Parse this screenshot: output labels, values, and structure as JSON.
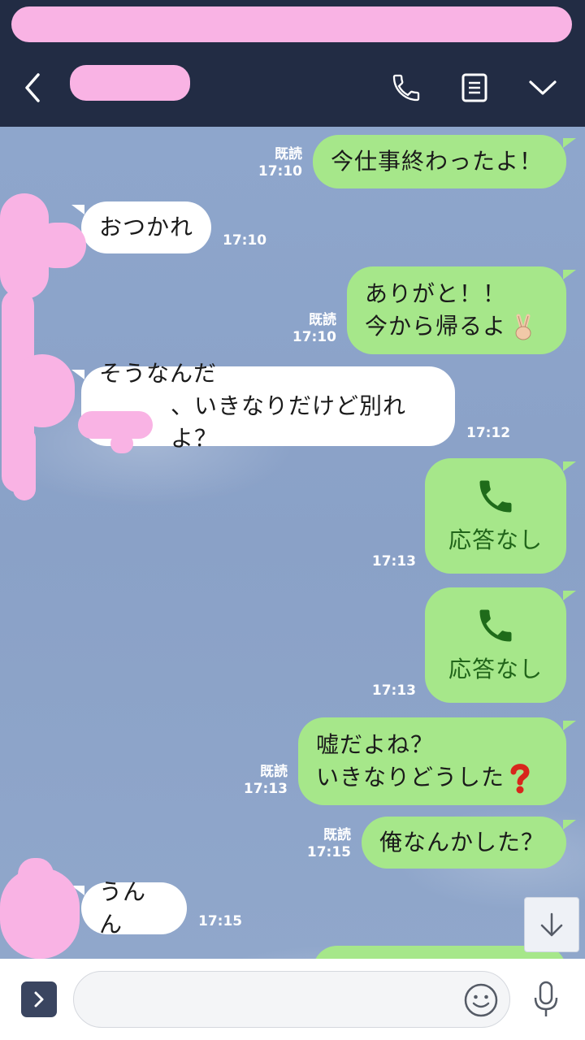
{
  "messages": [
    {
      "side": "out",
      "text": "今仕事終わったよ！",
      "read": "既読",
      "time": "17:10"
    },
    {
      "side": "in",
      "text": "おつかれ",
      "time": "17:10"
    },
    {
      "side": "out",
      "lines": [
        "ありがと！！",
        "今から帰るよ"
      ],
      "emoji": "victory-hand-emoji",
      "read": "既読",
      "time": "17:10"
    },
    {
      "side": "in",
      "lines": [
        "そうなんだ",
        "、いきなりだけど別れよ？"
      ],
      "time": "17:12"
    },
    {
      "side": "out",
      "type": "call",
      "text": "応答なし",
      "icon": "phone-icon",
      "time": "17:13"
    },
    {
      "side": "out",
      "type": "call",
      "text": "応答なし",
      "icon": "phone-icon",
      "time": "17:13"
    },
    {
      "side": "out",
      "lines": [
        "嘘だよね？",
        "いきなりどうした"
      ],
      "emoji": "red-question-mark-emoji",
      "read": "既読",
      "time": "17:13"
    },
    {
      "side": "out",
      "text": "俺なんかした？",
      "read": "既読",
      "time": "17:15"
    },
    {
      "side": "in",
      "text": "うんん",
      "time": "17:15"
    }
  ],
  "colors": {
    "header_bg": "#222c44",
    "bubble_out": "#a6e78a",
    "bubble_in": "#ffffff",
    "call_text": "#21651a",
    "redaction": "#f9b3e4"
  },
  "header": {
    "icons": [
      "back-chevron-icon",
      "phone-icon",
      "notes-icon",
      "chevron-down-icon"
    ]
  },
  "input": {
    "placeholder": "",
    "icons": [
      "expand-chevron-icon",
      "smiley-icon",
      "microphone-icon",
      "scroll-down-arrow-icon"
    ]
  }
}
